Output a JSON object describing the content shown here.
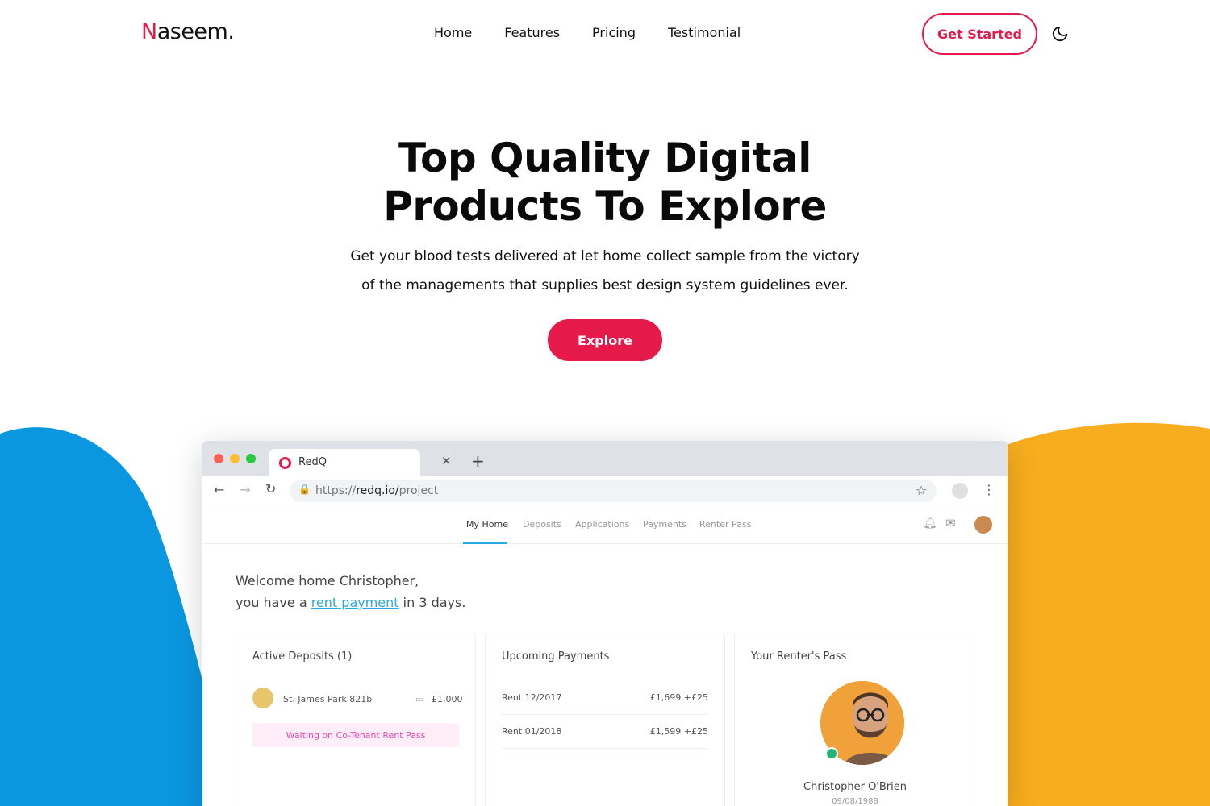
{
  "nav": {
    "logo_first": "N",
    "logo_rest": "aseem.",
    "items": [
      {
        "label": "Home"
      },
      {
        "label": "Features"
      },
      {
        "label": "Pricing"
      },
      {
        "label": "Testimonial"
      }
    ],
    "cta": "Get Started",
    "theme_toggle_icon": "moon-icon"
  },
  "hero": {
    "title_line1": "Top Quality Digital",
    "title_line2": "Products To Explore",
    "subtitle_line1": "Get your blood tests delivered at let home collect sample from the victory",
    "subtitle_line2": "of the managements that supplies best design system guidelines ever.",
    "button": "Explore"
  },
  "colors": {
    "accent": "#e5194a",
    "blob_left": "#0a97e0",
    "blob_right": "#f7ad1e",
    "link": "#2aa8e0"
  },
  "mockup": {
    "tab_label": "RedQ",
    "url_scheme": "https://",
    "url_host": "redq.io/",
    "url_path": "project",
    "app_tabs": [
      {
        "label": "My Home"
      },
      {
        "label": "Deposits"
      },
      {
        "label": "Applications"
      },
      {
        "label": "Payments"
      },
      {
        "label": "Renter Pass"
      }
    ],
    "welcome_line1": "Welcome home Christopher,",
    "welcome_pre": "you have a ",
    "welcome_link": "rent payment",
    "welcome_post": " in 3 days.",
    "deposits": {
      "title": "Active Deposits (1)",
      "property": "St. James Park 821b",
      "amount": "£1,000",
      "status": "Waiting on Co-Tenant Rent Pass"
    },
    "payments": {
      "title": "Upcoming Payments",
      "rows": [
        {
          "label": "Rent 12/2017",
          "amount": "£1,699  +£25"
        },
        {
          "label": "Rent 01/2018",
          "amount": "£1,599 +£25"
        }
      ]
    },
    "pass": {
      "title": "Your Renter's Pass",
      "name": "Christopher O'Brien",
      "dob": "09/08/1988"
    }
  }
}
